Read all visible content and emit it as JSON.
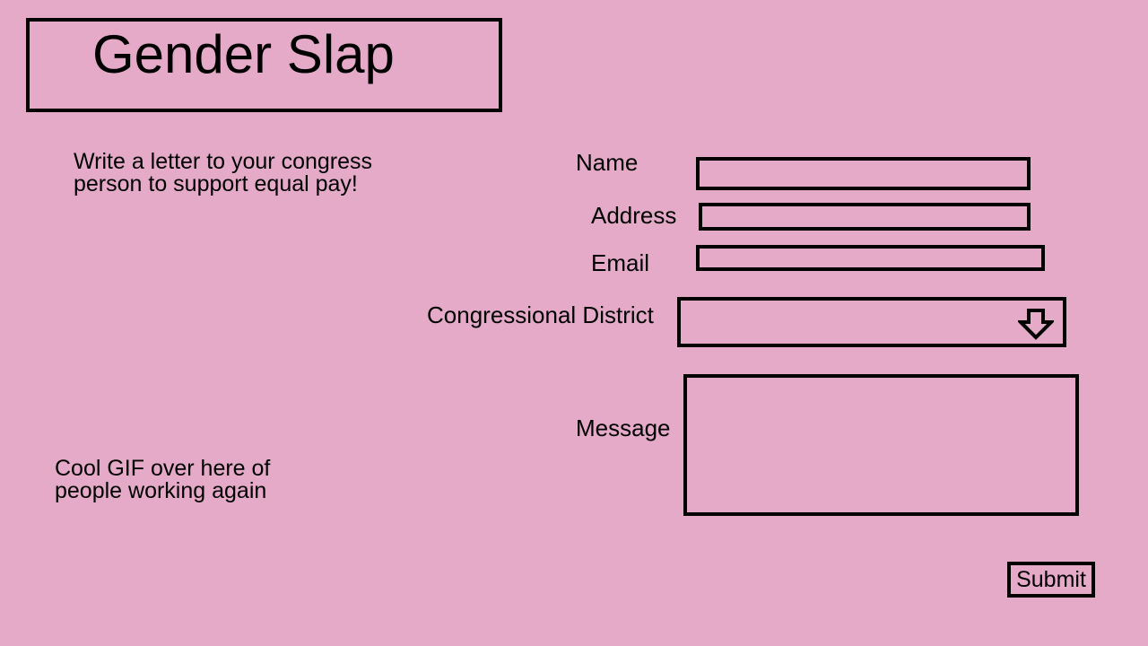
{
  "header": {
    "title": "Gender Slap"
  },
  "intro": {
    "text": "Write a letter to your congress person to support equal pay!"
  },
  "gif_placeholder": {
    "text": "Cool GIF over here of people working again"
  },
  "form": {
    "name_label": "Name",
    "name_value": "",
    "address_label": "Address",
    "address_value": "",
    "email_label": "Email",
    "email_value": "",
    "district_label": "Congressional District",
    "district_value": "",
    "district_icon": "down-arrow-icon",
    "message_label": "Message",
    "message_value": "",
    "submit_label": "Submit"
  },
  "colors": {
    "background": "#e4aac8",
    "border": "#000000",
    "text": "#000000"
  }
}
